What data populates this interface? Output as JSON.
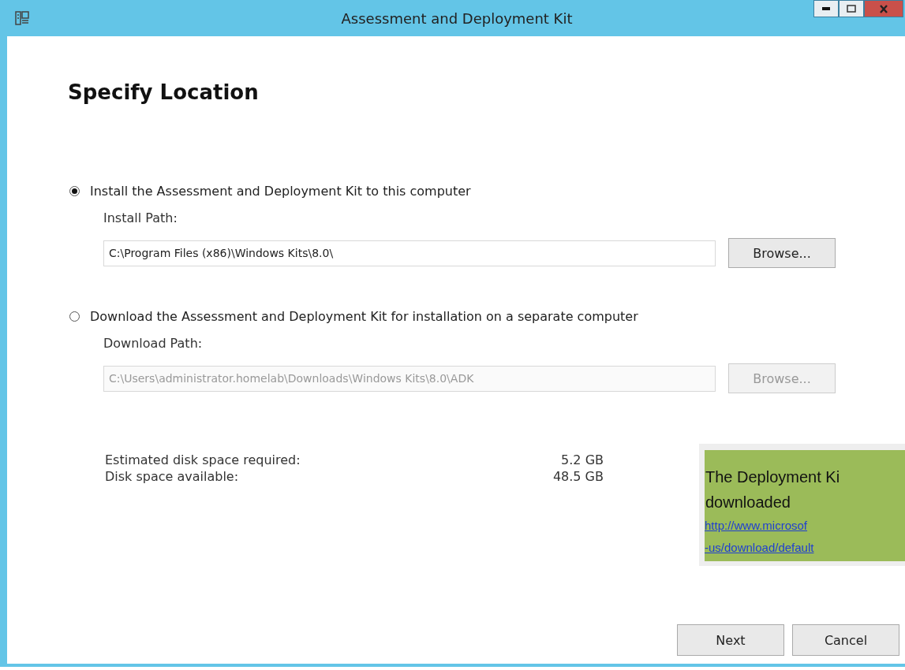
{
  "window": {
    "title": "Assessment and Deployment Kit"
  },
  "heading": "Specify Location",
  "options": [
    {
      "label": "Install the Assessment and Deployment Kit to this computer",
      "selected": true,
      "path_label": "Install Path:",
      "path_value": "C:\\Program Files (x86)\\Windows Kits\\8.0\\",
      "browse": "Browse...",
      "disabled": false
    },
    {
      "label": "Download the Assessment and Deployment Kit for installation on a separate computer",
      "selected": false,
      "path_label": "Download Path:",
      "path_value": "C:\\Users\\administrator.homelab\\Downloads\\Windows Kits\\8.0\\ADK",
      "browse": "Browse...",
      "disabled": true
    }
  ],
  "disk": [
    {
      "label": "Estimated disk space required:",
      "value": "5.2 GB"
    },
    {
      "label": "Disk space available:",
      "value": "48.5 GB"
    }
  ],
  "buttons": [
    "Next",
    "Cancel"
  ],
  "callout": {
    "lines": [
      {
        "kind": "text",
        "text": "The Deployment Ki"
      },
      {
        "kind": "text",
        "text": "downloaded"
      },
      {
        "kind": "link",
        "text": "http://www.microsof"
      },
      {
        "kind": "link",
        "text": "-us/download/default"
      }
    ]
  }
}
